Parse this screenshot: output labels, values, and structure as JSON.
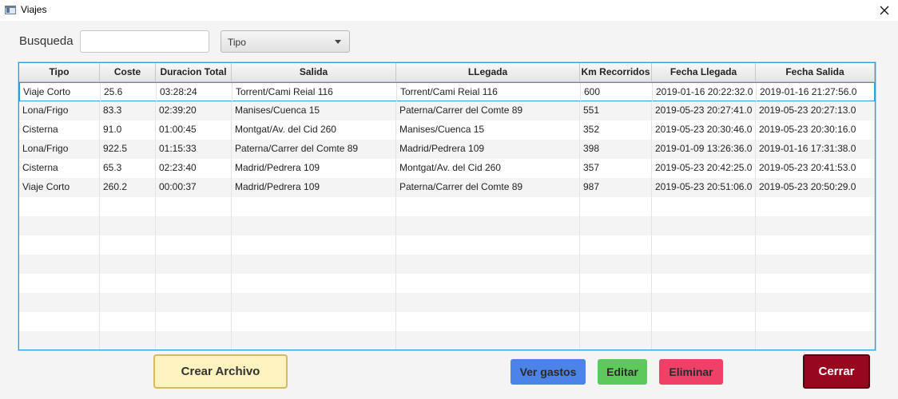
{
  "window": {
    "title": "Viajes"
  },
  "search": {
    "label": "Busqueda",
    "value": "",
    "placeholder": ""
  },
  "type_select": {
    "selected": "Tipo"
  },
  "table": {
    "columns": [
      "Tipo",
      "Coste",
      "Duracion Total",
      "Salida",
      "LLegada",
      "Km Recorridos",
      "Fecha Llegada",
      "Fecha Salida"
    ],
    "rows": [
      [
        "Viaje Corto",
        "25.6",
        "03:28:24",
        "Torrent/Cami Reial 116",
        "Torrent/Cami Reial 116",
        "600",
        "2019-01-16 20:22:32.0",
        "2019-01-16 21:27:56.0"
      ],
      [
        "Lona/Frigo",
        "83.3",
        "02:39:20",
        "Manises/Cuenca 15",
        "Paterna/Carrer del Comte 89",
        "551",
        "2019-05-23 20:27:41.0",
        "2019-05-23 20:27:13.0"
      ],
      [
        "Cisterna",
        "91.0",
        "01:00:45",
        "Montgat/Av. del Cid 260",
        "Manises/Cuenca 15",
        "352",
        "2019-05-23 20:30:46.0",
        "2019-05-23 20:30:16.0"
      ],
      [
        "Lona/Frigo",
        "922.5",
        "01:15:33",
        "Paterna/Carrer del Comte 89",
        "Madrid/Pedrera 109",
        "398",
        "2019-01-09 13:26:36.0",
        "2019-01-16 17:31:38.0"
      ],
      [
        "Cisterna",
        "65.3",
        "02:23:40",
        "Madrid/Pedrera 109",
        "Montgat/Av. del Cid 260",
        "357",
        "2019-05-23 20:42:25.0",
        "2019-05-23 20:41:53.0"
      ],
      [
        "Viaje Corto",
        "260.2",
        "00:00:37",
        "Madrid/Pedrera 109",
        "Paterna/Carrer del Comte 89",
        "987",
        "2019-05-23 20:51:06.0",
        "2019-05-23 20:50:29.0"
      ]
    ],
    "selected_row": 0
  },
  "buttons": {
    "crear": "Crear Archivo",
    "ver_gastos": "Ver gastos",
    "editar": "Editar",
    "eliminar": "Eliminar",
    "cerrar": "Cerrar"
  },
  "icons": {
    "window": "app-window-icon",
    "close": "close-icon",
    "dropdown": "chevron-down-icon"
  },
  "colors": {
    "focus_border": "#2b9fd6",
    "crear_bg": "#fdf2c0",
    "ver_gastos_bg": "#4c83e8",
    "editar_bg": "#5dc95a",
    "eliminar_bg": "#ef4168",
    "cerrar_bg": "#97081f"
  }
}
